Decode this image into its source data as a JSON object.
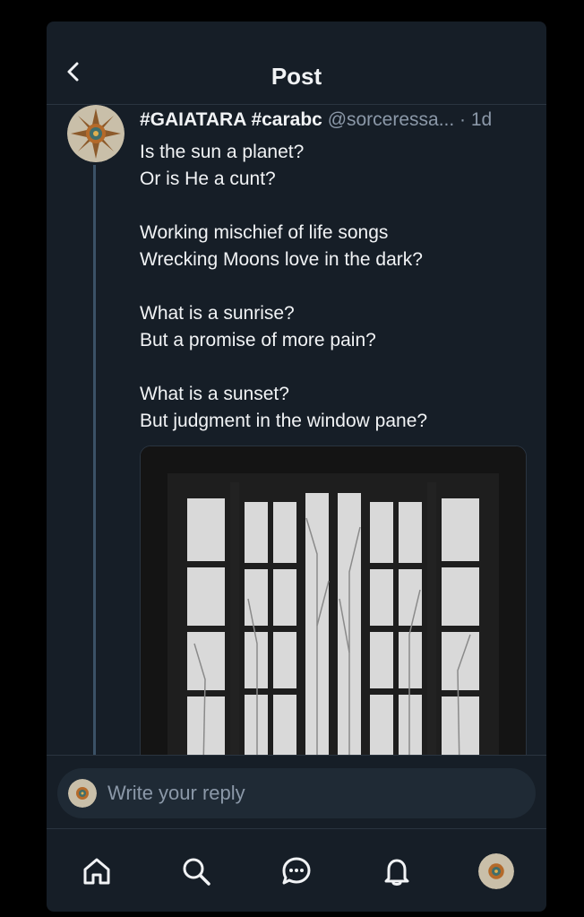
{
  "header": {
    "title": "Post",
    "back_icon": "chevron-left-icon"
  },
  "post": {
    "author_display": "#GAIATARA #carabc",
    "handle": "@sorceressa...",
    "time": " · 1d",
    "lines": [
      "Is the sun a planet?",
      "Or is He a cunt?",
      "Working mischief of life songs",
      "Wrecking Moons love in the dark?",
      "What is a sunrise?",
      "But a promise of more pain?",
      "What is a sunset?",
      "But judgment in the window pane?"
    ],
    "image_subject": "open-window-photo"
  },
  "reply": {
    "placeholder": "Write your reply"
  },
  "tabbar": {
    "items": [
      "home-icon",
      "search-icon",
      "chat-icon",
      "bell-icon",
      "profile-avatar"
    ]
  },
  "colors": {
    "background": "#161e27",
    "text": "#f1f3f5",
    "muted": "#8b98a8",
    "thread": "#3b5166"
  }
}
